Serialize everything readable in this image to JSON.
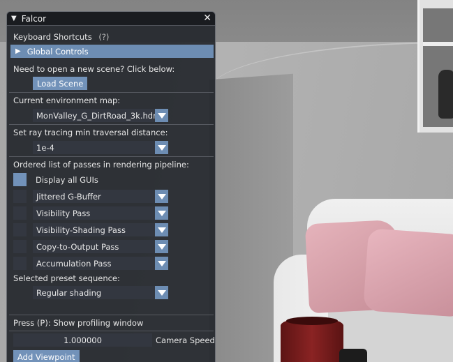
{
  "window": {
    "title": "Falcor",
    "close_glyph": "✕",
    "collapse_glyph": "▼"
  },
  "shortcuts": {
    "label": "Keyboard Shortcuts",
    "help": "(?)"
  },
  "global_controls": {
    "label": "Global Controls",
    "arrow_glyph": "▶"
  },
  "scene": {
    "prompt": "Need to open a new scene?  Click below:",
    "load_button": "Load Scene"
  },
  "environment": {
    "label": "Current environment map:",
    "value": "MonValley_G_DirtRoad_3k.hdr"
  },
  "ray_tracing": {
    "label": "Set ray tracing min traversal distance:",
    "value": "1e-4"
  },
  "passes": {
    "label": "Ordered list of passes in rendering pipeline:",
    "display_all": "Display all GUIs",
    "display_all_checked": true,
    "items": [
      {
        "label": "Jittered G-Buffer",
        "checked": false
      },
      {
        "label": "Visibility Pass",
        "checked": false
      },
      {
        "label": "Visibility-Shading Pass",
        "checked": false
      },
      {
        "label": "Copy-to-Output Pass",
        "checked": false
      },
      {
        "label": "Accumulation Pass",
        "checked": false
      }
    ]
  },
  "preset": {
    "label": "Selected preset sequence:",
    "value": "Regular shading"
  },
  "profiling": {
    "label": "Press (P):  Show profiling window"
  },
  "camera": {
    "speed_value": "1.000000",
    "speed_label": "Camera Speed"
  },
  "viewport": {
    "add_button": "Add Viewpoint"
  },
  "colors": {
    "accent": "#6d8db3",
    "panel_bg": "#25282d",
    "widget_bg": "#333740"
  }
}
